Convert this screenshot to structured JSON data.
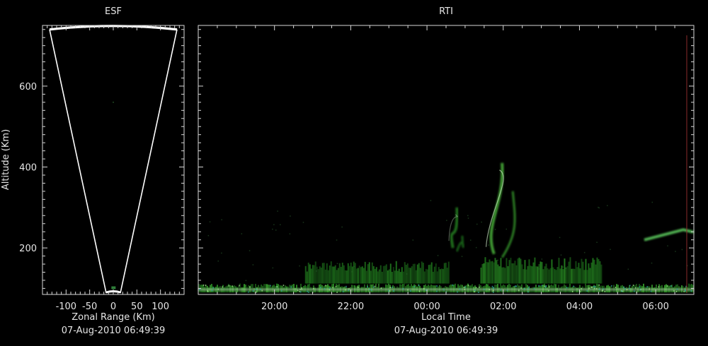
{
  "colors": {
    "background": "#000000",
    "axis": "#d8d8d8",
    "cone": "#ffffff",
    "echo": "#3fae4a",
    "echo_bright": "#d8f0d0",
    "edge_marker": "#a03030"
  },
  "chart_data": [
    {
      "type": "scatter",
      "title": "ESF",
      "xlabel": "Zonal Range (Km)",
      "ylabel": "Altitude (Km)",
      "subtitle": "07-Aug-2010 06:49:39",
      "xlim": [
        -150,
        150
      ],
      "ylim": [
        85,
        750
      ],
      "xticks": [
        -100,
        -50,
        0,
        50,
        100
      ],
      "xtick_labels": [
        "-100",
        "-50",
        "0",
        "50",
        "100"
      ],
      "yticks": [
        200,
        400,
        600
      ],
      "ytick_labels": [
        "200",
        "400",
        "600"
      ],
      "cone": {
        "base_x": [
          -15,
          15
        ],
        "base_y": 85,
        "top_x": [
          -135,
          135
        ],
        "top_y": 740
      }
    },
    {
      "type": "heatmap",
      "title": "RTI",
      "xlabel": "Local Time",
      "subtitle": "07-Aug-2010 06:49:39",
      "xlim": [
        18.0,
        31.0
      ],
      "ylim": [
        85,
        750
      ],
      "xticks": [
        20,
        22,
        24,
        26,
        28,
        30
      ],
      "xtick_labels": [
        "20:00",
        "22:00",
        "00:00",
        "02:00",
        "04:00",
        "06:00"
      ],
      "yticks": [
        200,
        400,
        600
      ],
      "echoes": [
        {
          "kind": "band",
          "t": [
            18.0,
            31.0
          ],
          "alt": [
            90,
            112
          ],
          "intensity": 0.75
        },
        {
          "kind": "band",
          "t": [
            20.8,
            24.6
          ],
          "alt": [
            112,
            168
          ],
          "intensity": 0.45
        },
        {
          "kind": "band",
          "t": [
            25.4,
            28.6
          ],
          "alt": [
            112,
            178
          ],
          "intensity": 0.55
        },
        {
          "kind": "plume",
          "t": [
            25.2,
            26.6
          ],
          "alt": [
            185,
            410
          ],
          "intensity": 0.9
        },
        {
          "kind": "plume",
          "t": [
            24.4,
            25.1
          ],
          "alt": [
            200,
            300
          ],
          "intensity": 0.5
        },
        {
          "kind": "streak",
          "t": [
            29.7,
            31.0
          ],
          "alt": [
            220,
            245
          ],
          "intensity": 0.8
        }
      ]
    }
  ]
}
